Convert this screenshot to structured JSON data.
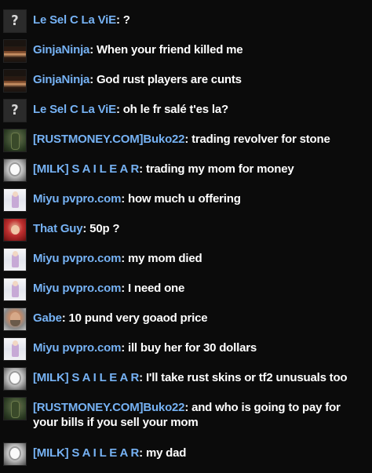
{
  "messages": [
    {
      "avatar": "question-mark-avatar",
      "avatar_glyph": "?",
      "name": "Le Sel C La ViE",
      "text": "?"
    },
    {
      "avatar": "ninja-avatar",
      "name": "GinjaNinja",
      "text": "When your friend killed me"
    },
    {
      "avatar": "ninja-avatar",
      "name": "GinjaNinja",
      "text": "God rust players are cunts"
    },
    {
      "avatar": "question-mark-avatar",
      "avatar_glyph": "?",
      "name": "Le Sel C La ViE",
      "text": "oh le fr salé t'es la?"
    },
    {
      "avatar": "rust-avatar",
      "name": "[RUSTMONEY.COM]Buko22",
      "text": "trading revolver for stone"
    },
    {
      "avatar": "milk-avatar",
      "name": "[MILK] S A I L E A R",
      "text": "trading my mom for money"
    },
    {
      "avatar": "miyu-avatar",
      "name": "Miyu pvpro.com",
      "text": "how much u offering"
    },
    {
      "avatar": "thatguy-avatar",
      "name": "That Guy",
      "text": "50p ?"
    },
    {
      "avatar": "miyu-avatar",
      "name": "Miyu pvpro.com",
      "text": "my mom died"
    },
    {
      "avatar": "miyu-avatar",
      "name": "Miyu pvpro.com",
      "text": "I need one"
    },
    {
      "avatar": "gabe-avatar",
      "name": "Gabe",
      "text": "10 pund very goaod price"
    },
    {
      "avatar": "miyu-avatar",
      "name": "Miyu pvpro.com",
      "text": "ill buy her for 30 dollars"
    },
    {
      "avatar": "milk-avatar",
      "name": "[MILK] S A I L E A R",
      "text": "I'll take rust skins or tf2 unusuals too"
    },
    {
      "avatar": "rust-avatar",
      "name": "[RUSTMONEY.COM]Buko22",
      "text": "and who is going to pay for your bills if you sell your mom"
    },
    {
      "avatar": "milk-avatar",
      "name": "[MILK] S A I L E A R",
      "text": "my dad"
    }
  ],
  "separator": ": ",
  "colors": {
    "background": "#0b0b0b",
    "name": "#76b2f4",
    "text": "#ffffff"
  }
}
